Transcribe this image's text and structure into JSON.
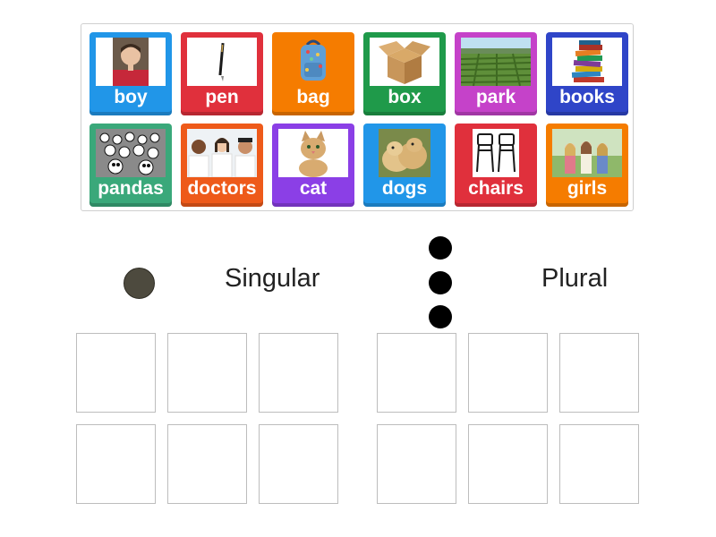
{
  "tiles": [
    {
      "word": "boy",
      "color": "#2196e8",
      "icon": "boy-photo"
    },
    {
      "word": "pen",
      "color": "#e0303c",
      "icon": "pen-photo"
    },
    {
      "word": "bag",
      "color": "#f57c00",
      "icon": "bag-photo"
    },
    {
      "word": "box",
      "color": "#1f9a4a",
      "icon": "box-photo"
    },
    {
      "word": "park",
      "color": "#c542c9",
      "icon": "park-photo"
    },
    {
      "word": "books",
      "color": "#2f45c8",
      "icon": "books-photo"
    },
    {
      "word": "pandas",
      "color": "#3aa87a",
      "icon": "pandas-photo"
    },
    {
      "word": "doctors",
      "color": "#ee5a1a",
      "icon": "doctors-photo"
    },
    {
      "word": "cat",
      "color": "#8b3fe6",
      "icon": "cat-photo"
    },
    {
      "word": "dogs",
      "color": "#2196e8",
      "icon": "dogs-photo"
    },
    {
      "word": "chairs",
      "color": "#e0303c",
      "icon": "chairs-photo"
    },
    {
      "word": "girls",
      "color": "#f57c00",
      "icon": "girls-photo"
    }
  ],
  "groups": {
    "singular": "Singular",
    "plural": "Plural"
  },
  "colors": {
    "handle_dot": "#4d4a3e",
    "menu_dots": "#000000"
  },
  "icons": {
    "handle": "drag-handle-dot",
    "menu": "vertical-dots-menu-icon"
  }
}
